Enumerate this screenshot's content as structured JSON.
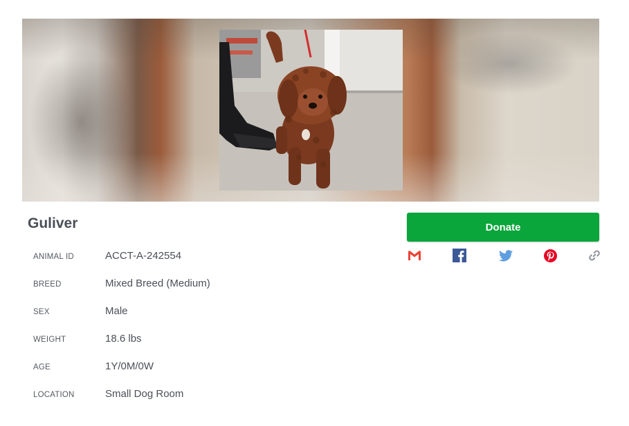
{
  "animal": {
    "name": "Guliver",
    "details": [
      {
        "label": "ANIMAL ID",
        "value": "ACCT-A-242554"
      },
      {
        "label": "BREED",
        "value": "Mixed Breed (Medium)"
      },
      {
        "label": "SEX",
        "value": "Male"
      },
      {
        "label": "WEIGHT",
        "value": "18.6 lbs"
      },
      {
        "label": "AGE",
        "value": "1Y/0M/0W"
      },
      {
        "label": "LOCATION",
        "value": "Small Dog Room"
      }
    ]
  },
  "actions": {
    "donate_label": "Donate"
  },
  "share": {
    "icons": [
      "gmail-icon",
      "facebook-icon",
      "twitter-icon",
      "pinterest-icon",
      "link-icon"
    ]
  },
  "colors": {
    "donate_green": "#0aa53b",
    "text_primary": "#4a4f57",
    "gmail_red": "#ea4335",
    "facebook_blue": "#3b5998",
    "twitter_blue": "#1da1f2",
    "pinterest_red": "#e60023",
    "link_gray": "#8a9099"
  }
}
